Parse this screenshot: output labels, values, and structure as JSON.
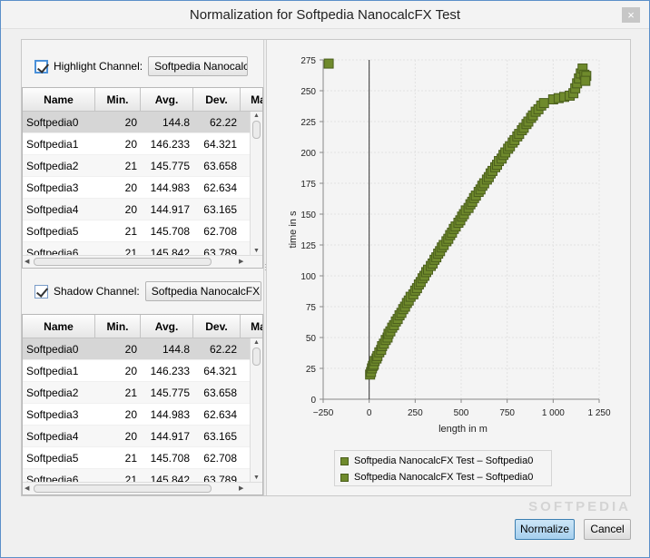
{
  "window": {
    "title": "Normalization for Softpedia NanocalcFX Test",
    "close_label": "×"
  },
  "highlight": {
    "checkbox_label": "Highlight Channel:",
    "checked": true,
    "selected_channel": "Softpedia NanocalcFX"
  },
  "shadow": {
    "checkbox_label": "Shadow Channel:",
    "checked": true,
    "selected_channel": "Softpedia NanocalcFX Te"
  },
  "table_columns": [
    "Name",
    "Min.",
    "Avg.",
    "Dev.",
    "Ma"
  ],
  "table_rows": [
    {
      "name": "Softpedia0",
      "min": "20",
      "avg": "144.8",
      "dev": "62.22"
    },
    {
      "name": "Softpedia1",
      "min": "20",
      "avg": "146.233",
      "dev": "64.321"
    },
    {
      "name": "Softpedia2",
      "min": "21",
      "avg": "145.775",
      "dev": "63.658"
    },
    {
      "name": "Softpedia3",
      "min": "20",
      "avg": "144.983",
      "dev": "62.634"
    },
    {
      "name": "Softpedia4",
      "min": "20",
      "avg": "144.917",
      "dev": "63.165"
    },
    {
      "name": "Softpedia5",
      "min": "21",
      "avg": "145.708",
      "dev": "62.708"
    },
    {
      "name": "Softpedia6",
      "min": "21",
      "avg": "145.842",
      "dev": "63.789"
    }
  ],
  "buttons": {
    "normalize": "Normalize",
    "cancel": "Cancel"
  },
  "watermark": "SOFTPEDIA",
  "colors": {
    "marker_fill": "#6f8a2c",
    "marker_stroke": "#4a5e1c",
    "accent": "#3c7fb1"
  },
  "chart_data": {
    "type": "scatter",
    "xlabel": "length in m",
    "ylabel": "time in s",
    "xlim": [
      -250,
      1250
    ],
    "ylim": [
      0,
      275
    ],
    "xticks": [
      "−250",
      "0",
      "250",
      "500",
      "750",
      "1 000",
      "1 250"
    ],
    "yticks": [
      "0",
      "25",
      "50",
      "75",
      "100",
      "125",
      "150",
      "175",
      "200",
      "225",
      "250",
      "275"
    ],
    "grid": true,
    "legend_position": "bottom",
    "series": [
      {
        "name": "Softpedia NanocalcFX Test – Softpedia0",
        "points": [
          [
            -220,
            272
          ],
          [
            5,
            20
          ],
          [
            10,
            22
          ],
          [
            15,
            25
          ],
          [
            20,
            27
          ],
          [
            25,
            28
          ],
          [
            30,
            31
          ],
          [
            40,
            33
          ],
          [
            45,
            35
          ],
          [
            55,
            38
          ],
          [
            65,
            40
          ],
          [
            70,
            43
          ],
          [
            80,
            45
          ],
          [
            90,
            48
          ],
          [
            100,
            50
          ],
          [
            105,
            53
          ],
          [
            115,
            55
          ],
          [
            125,
            58
          ],
          [
            135,
            60
          ],
          [
            145,
            63
          ],
          [
            155,
            65
          ],
          [
            165,
            68
          ],
          [
            175,
            70
          ],
          [
            185,
            73
          ],
          [
            195,
            75
          ],
          [
            205,
            78
          ],
          [
            215,
            80
          ],
          [
            225,
            83
          ],
          [
            240,
            85
          ],
          [
            250,
            88
          ],
          [
            260,
            90
          ],
          [
            270,
            93
          ],
          [
            280,
            95
          ],
          [
            290,
            98
          ],
          [
            300,
            100
          ],
          [
            310,
            103
          ],
          [
            320,
            105
          ],
          [
            335,
            108
          ],
          [
            345,
            110
          ],
          [
            355,
            113
          ],
          [
            365,
            115
          ],
          [
            375,
            118
          ],
          [
            385,
            120
          ],
          [
            395,
            123
          ],
          [
            405,
            125
          ],
          [
            420,
            128
          ],
          [
            430,
            130
          ],
          [
            440,
            133
          ],
          [
            450,
            135
          ],
          [
            460,
            138
          ],
          [
            470,
            140
          ],
          [
            485,
            143
          ],
          [
            495,
            145
          ],
          [
            505,
            148
          ],
          [
            515,
            150
          ],
          [
            525,
            153
          ],
          [
            540,
            155
          ],
          [
            550,
            158
          ],
          [
            560,
            160
          ],
          [
            570,
            163
          ],
          [
            580,
            165
          ],
          [
            595,
            168
          ],
          [
            605,
            170
          ],
          [
            615,
            173
          ],
          [
            625,
            175
          ],
          [
            640,
            178
          ],
          [
            650,
            180
          ],
          [
            660,
            183
          ],
          [
            670,
            185
          ],
          [
            685,
            188
          ],
          [
            695,
            190
          ],
          [
            705,
            193
          ],
          [
            720,
            195
          ],
          [
            730,
            198
          ],
          [
            740,
            200
          ],
          [
            755,
            203
          ],
          [
            765,
            205
          ],
          [
            780,
            208
          ],
          [
            790,
            210
          ],
          [
            805,
            213
          ],
          [
            815,
            215
          ],
          [
            830,
            218
          ],
          [
            840,
            220
          ],
          [
            855,
            223
          ],
          [
            865,
            225
          ],
          [
            880,
            228
          ],
          [
            890,
            230
          ],
          [
            905,
            233
          ],
          [
            920,
            235
          ],
          [
            935,
            238
          ],
          [
            950,
            240
          ],
          [
            1000,
            243
          ],
          [
            1030,
            244
          ],
          [
            1060,
            245
          ],
          [
            1090,
            246
          ],
          [
            1110,
            248
          ],
          [
            1120,
            252
          ],
          [
            1130,
            256
          ],
          [
            1140,
            260
          ],
          [
            1150,
            264
          ],
          [
            1160,
            268
          ],
          [
            1170,
            263
          ],
          [
            1180,
            262
          ],
          [
            1175,
            258
          ]
        ]
      }
    ],
    "legend_entries": [
      "Softpedia NanocalcFX Test – Softpedia0",
      "Softpedia NanocalcFX Test – Softpedia0"
    ]
  }
}
